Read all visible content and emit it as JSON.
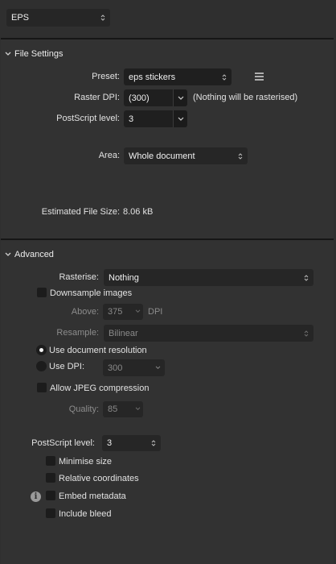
{
  "format": {
    "value": "EPS"
  },
  "file_settings": {
    "title": "File Settings",
    "preset_label": "Preset:",
    "preset_value": "eps stickers",
    "raster_dpi_label": "Raster DPI:",
    "raster_dpi_value": "(300)",
    "raster_note": "(Nothing will be rasterised)",
    "postscript_label": "PostScript level:",
    "postscript_value": "3",
    "area_label": "Area:",
    "area_value": "Whole document",
    "estimated_label": "Estimated File Size:",
    "estimated_value": "8.06 kB"
  },
  "advanced": {
    "title": "Advanced",
    "rasterise_label": "Rasterise:",
    "rasterise_value": "Nothing",
    "downsample_label": "Downsample images",
    "above_label": "Above:",
    "above_value": "375",
    "above_unit": "DPI",
    "resample_label": "Resample:",
    "resample_value": "Bilinear",
    "use_doc_res_label": "Use document resolution",
    "use_dpi_label": "Use DPI:",
    "use_dpi_value": "300",
    "jpeg_label": "Allow JPEG compression",
    "quality_label": "Quality:",
    "quality_value": "85",
    "postscript_label": "PostScript level:",
    "postscript_value": "3",
    "minimise_label": "Minimise size",
    "relative_label": "Relative coordinates",
    "embed_label": "Embed metadata",
    "bleed_label": "Include bleed",
    "info_glyph": "i"
  },
  "icons": {
    "menu": "hamburger-menu-icon",
    "chevron": "chevron-down-icon",
    "updown": "updown-arrows-icon",
    "info": "info-icon"
  }
}
